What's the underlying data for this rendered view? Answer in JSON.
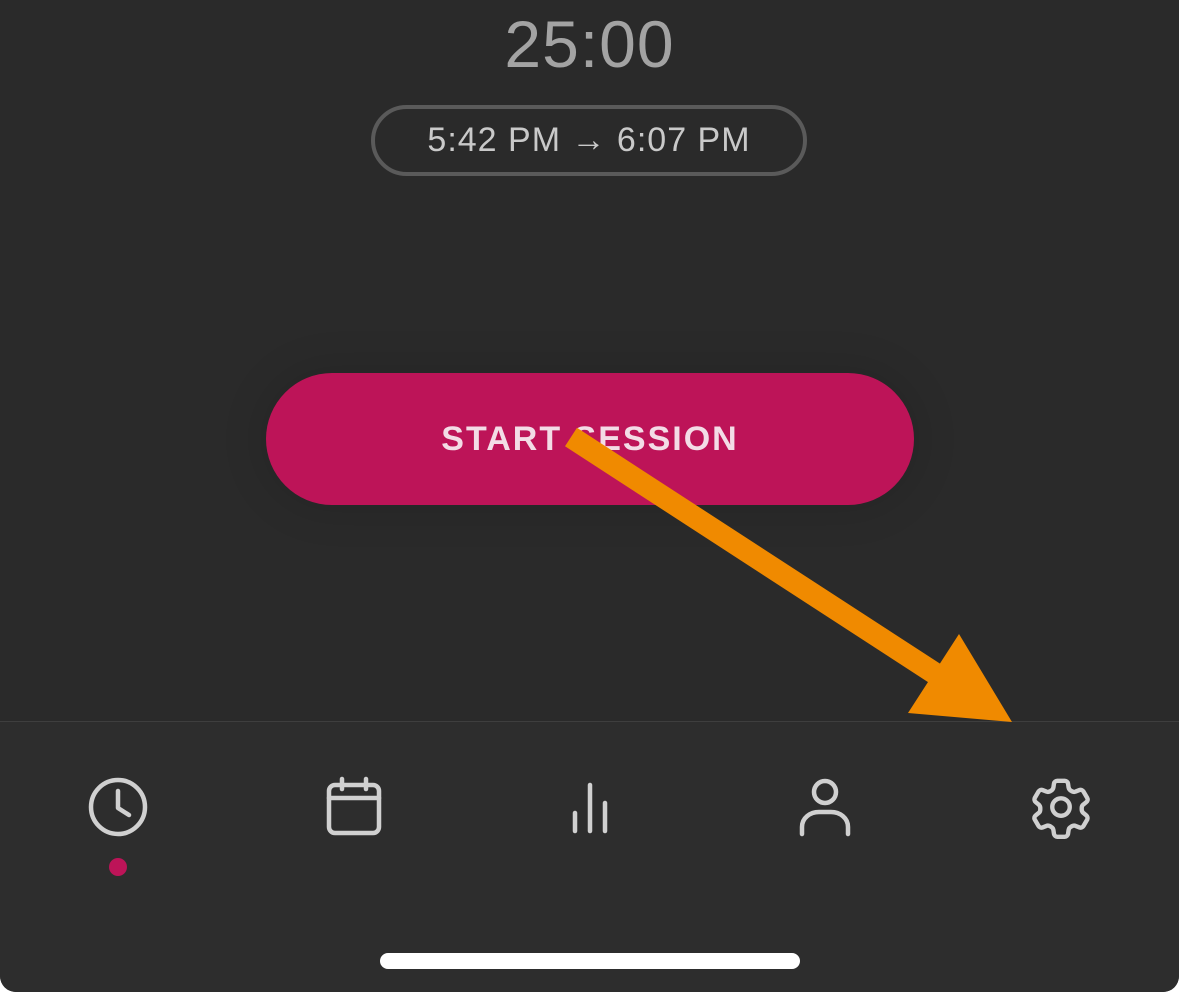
{
  "timer": {
    "display": "25:00",
    "range": "5:42 PM → 6:07 PM"
  },
  "start_button": {
    "label": "START SESSION"
  },
  "tab_bar": {
    "tabs": [
      {
        "icon": "clock-icon",
        "active": true
      },
      {
        "icon": "calendar-icon",
        "active": false
      },
      {
        "icon": "bar-chart-icon",
        "active": false
      },
      {
        "icon": "person-icon",
        "active": false
      },
      {
        "icon": "gear-icon",
        "active": false
      }
    ]
  },
  "colors": {
    "background": "#2a2a2a",
    "accent": "#bd1458",
    "icon": "#d0d0d0",
    "annotation": "#f08a00"
  }
}
